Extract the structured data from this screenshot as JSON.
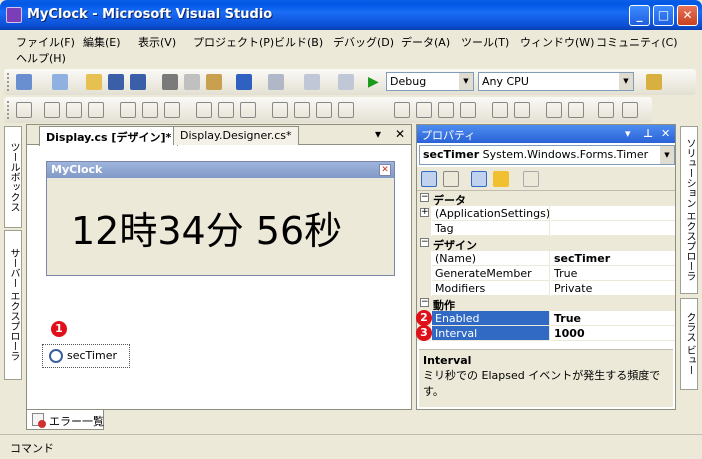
{
  "window": {
    "title": "MyClock - Microsoft Visual Studio"
  },
  "menu": [
    "ファイル(F)",
    "編集(E)",
    "表示(V)",
    "プロジェクト(P)",
    "ビルド(B)",
    "デバッグ(D)",
    "データ(A)",
    "ツール(T)",
    "ウィンドウ(W)",
    "コミュニティ(C)",
    "ヘルプ(H)"
  ],
  "toolbar": {
    "config": "Debug",
    "platform": "Any CPU"
  },
  "left_tabs": [
    "ツールボックス",
    "サーバー エクスプローラ"
  ],
  "right_tabs": [
    "ソリューション エクスプローラ",
    "クラス ビュー"
  ],
  "tabs": {
    "design": "Display.cs [デザイン]*",
    "designer_code": "Display.Designer.cs*"
  },
  "form": {
    "title": "MyClock",
    "clock_text": "12時34分 56秒"
  },
  "tray": {
    "component": "secTimer"
  },
  "badges": [
    "1",
    "2",
    "3"
  ],
  "properties": {
    "title": "プロパティ",
    "object_name": "secTimer",
    "object_type": "System.Windows.Forms.Timer",
    "categories": {
      "data": "データ",
      "design": "デザイン",
      "behavior": "動作"
    },
    "rows": {
      "app_settings": {
        "name": "(ApplicationSettings)",
        "value": ""
      },
      "tag": {
        "name": "Tag",
        "value": ""
      },
      "name": {
        "name": "(Name)",
        "value": "secTimer"
      },
      "generate_member": {
        "name": "GenerateMember",
        "value": "True"
      },
      "modifiers": {
        "name": "Modifiers",
        "value": "Private"
      },
      "enabled": {
        "name": "Enabled",
        "value": "True"
      },
      "interval": {
        "name": "Interval",
        "value": "1000"
      }
    },
    "description": {
      "title": "Interval",
      "text": "ミリ秒での Elapsed イベントが発生する頻度です。"
    }
  },
  "error_list": "エラー一覧",
  "status": "コマンド"
}
